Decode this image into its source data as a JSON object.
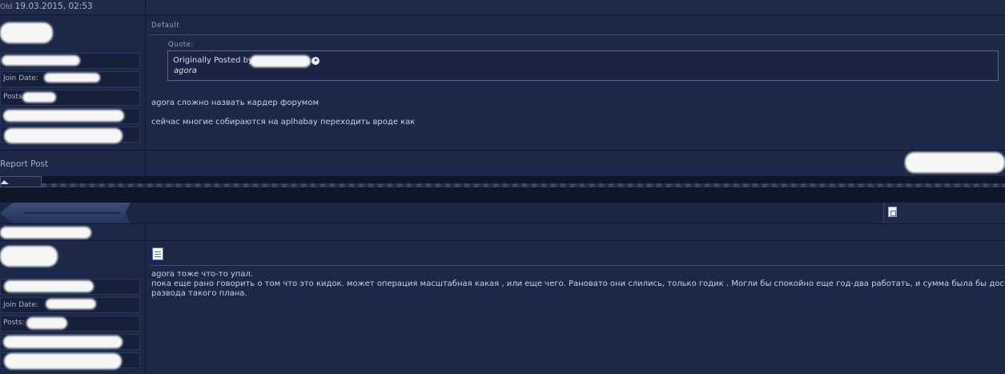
{
  "post1": {
    "date_prefix": "Old",
    "date": "19.03.2015, 02:53",
    "title": "Default",
    "userinfo": {
      "join_date_label": "Join Date:",
      "posts_label": "Posts"
    },
    "quote": {
      "label": "Quote:",
      "originally_posted_by": "Originally Posted by",
      "text": "agora"
    },
    "body_lines": [
      "agora сложно назвать кардер форумом",
      "сейчас многие собираются на aplhabay переходить вроде как"
    ],
    "report_label": "Report Post"
  },
  "post2": {
    "userinfo": {
      "join_date_label": "Join Date:",
      "posts_label": "Posts:"
    },
    "body_lines": [
      "agora тоже что-то упал.",
      "пока еще рано говорить о том что это кидок. может операция масштабная какая , или еще чего. Рановато они слились, только годик . Могли бы спокойно еще год-два работать, и сумма была бы достойной",
      "развода такого плана."
    ]
  },
  "icons": {
    "quote_link": "view-post-arrow-icon",
    "separator_tab": "arrow-up-icon",
    "post2_header": "post-link-icon",
    "post2_title": "document-icon"
  },
  "colors": {
    "background": "#1c2847",
    "text": "#c8d0e0",
    "quote_border": "#56658c"
  }
}
